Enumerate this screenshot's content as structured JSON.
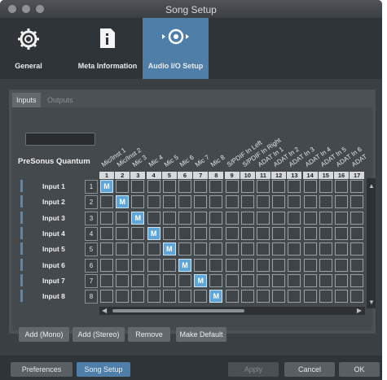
{
  "window": {
    "title": "Song Setup"
  },
  "toolbar": {
    "items": [
      {
        "label": "General",
        "icon": "gear-icon"
      },
      {
        "label": "Meta Information",
        "icon": "document-info-icon"
      },
      {
        "label": "Audio I/O Setup",
        "icon": "audio-io-icon",
        "active": true
      }
    ]
  },
  "tabs": [
    {
      "label": "Inputs",
      "active": true
    },
    {
      "label": "Outputs",
      "active": false
    }
  ],
  "device": {
    "name": "PreSonus Quantum"
  },
  "matrix": {
    "columns": [
      "Mic/Inst 1",
      "Mic/Inst 2",
      "Mic 3",
      "Mic 4",
      "Mic 5",
      "Mic 6",
      "Mic 7",
      "Mic 8",
      "S/PDIF In Left",
      "S/PDIF In Right",
      "ADAT In 1",
      "ADAT In 2",
      "ADAT In 3",
      "ADAT In 4",
      "ADAT In 5",
      "ADAT In 6",
      "ADAT"
    ],
    "column_numbers": [
      "1",
      "2",
      "3",
      "4",
      "5",
      "6",
      "7",
      "8",
      "9",
      "10",
      "11",
      "12",
      "13",
      "14",
      "15",
      "16",
      "17"
    ],
    "rows": [
      {
        "label": "Input 1",
        "num": "1"
      },
      {
        "label": "Input 2",
        "num": "2"
      },
      {
        "label": "Input 3",
        "num": "3"
      },
      {
        "label": "Input 4",
        "num": "4"
      },
      {
        "label": "Input 5",
        "num": "5"
      },
      {
        "label": "Input 6",
        "num": "6"
      },
      {
        "label": "Input 7",
        "num": "7"
      },
      {
        "label": "Input 8",
        "num": "8"
      }
    ],
    "cell_mark": "M",
    "assignments": [
      1,
      2,
      3,
      4,
      5,
      6,
      7,
      8
    ]
  },
  "actions": {
    "add_mono": "Add (Mono)",
    "add_stereo": "Add (Stereo)",
    "remove": "Remove",
    "make_default": "Make Default"
  },
  "footer": {
    "preferences": "Preferences",
    "song_setup": "Song Setup",
    "apply": "Apply",
    "cancel": "Cancel",
    "ok": "OK"
  }
}
